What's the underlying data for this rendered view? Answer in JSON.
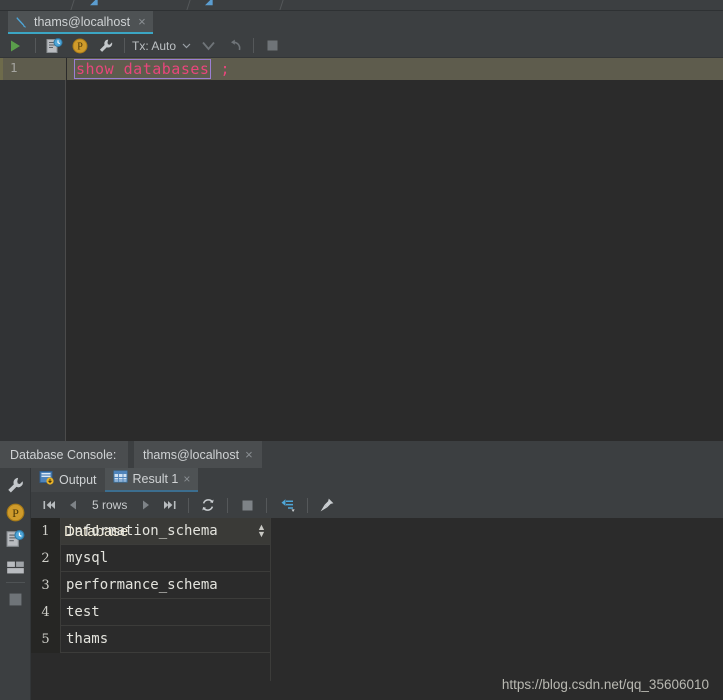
{
  "top_breadcrumbs": [
    {
      "icon": "db-console-icon",
      "label": ""
    },
    {
      "icon": "db-console-icon",
      "label": ""
    }
  ],
  "editor_tab": {
    "icon": "db-console-icon",
    "label": "thams@localhost",
    "close_label": "×"
  },
  "editor_toolbar": {
    "run_icon": "run-play-icon",
    "run_title": "Execute",
    "script_icon": "run-script-history-icon",
    "postgres_icon": "datasource-p-icon",
    "wrench_icon": "wrench-icon",
    "tx_label": "Tx: Auto",
    "tx_chevron": "chevron-down-icon",
    "commit_icon": "commit-check-icon",
    "rollback_icon": "rollback-undo-icon",
    "stop_icon": "stop-square-icon"
  },
  "editor": {
    "line_number": "1",
    "keyword_text": "show databases",
    "terminator": ";"
  },
  "console_header": {
    "label": "Database Console:",
    "tab_label": "thams@localhost",
    "tab_close": "×"
  },
  "left_rail": [
    {
      "icon": "wrench-icon",
      "name": "rail-wrench"
    },
    {
      "icon": "datasource-p-icon",
      "name": "rail-datasource"
    },
    {
      "icon": "run-script-history-icon",
      "name": "rail-script-history"
    },
    {
      "icon": "table-layout-icon",
      "name": "rail-table-layout"
    },
    {
      "icon": "stop-square-icon",
      "name": "rail-stop"
    }
  ],
  "result_tabs": [
    {
      "label": "Output",
      "icon": "output-console-icon",
      "active": false,
      "closable": false
    },
    {
      "label": "Result 1",
      "icon": "result-table-icon",
      "active": true,
      "closable": true,
      "close": "×"
    }
  ],
  "result_toolbar": {
    "first_page_icon": "first-page-icon",
    "prev_page_icon": "prev-page-icon",
    "rows_label": "5 rows",
    "next_page_icon": "next-page-icon",
    "last_page_icon": "last-page-icon",
    "reload_icon": "reload-icon",
    "stop_icon": "stop-square-icon",
    "transpose_icon": "transpose-icon",
    "pin_icon": "pin-icon"
  },
  "result_grid": {
    "columns": [
      "Database"
    ],
    "sort_icon": "sort-updown-icon",
    "rows": [
      {
        "n": "1",
        "Database": "information_schema"
      },
      {
        "n": "2",
        "Database": "mysql"
      },
      {
        "n": "3",
        "Database": "performance_schema"
      },
      {
        "n": "4",
        "Database": "test"
      },
      {
        "n": "5",
        "Database": "thams"
      }
    ]
  },
  "watermark": "https://blog.csdn.net/qq_35606010",
  "colors": {
    "window_bg": "#3c3f41",
    "editor_bg": "#2b2b2b",
    "caret_line": "#5e5c4d",
    "accent_tab_underline": "#3ba6c4",
    "keyword": "#e8467c",
    "keyword_border": "#9b7fd4",
    "run_green": "#5a9e4b",
    "datasource_orange": "#cf9b2b",
    "grid_header_text": "#f0ead8"
  }
}
